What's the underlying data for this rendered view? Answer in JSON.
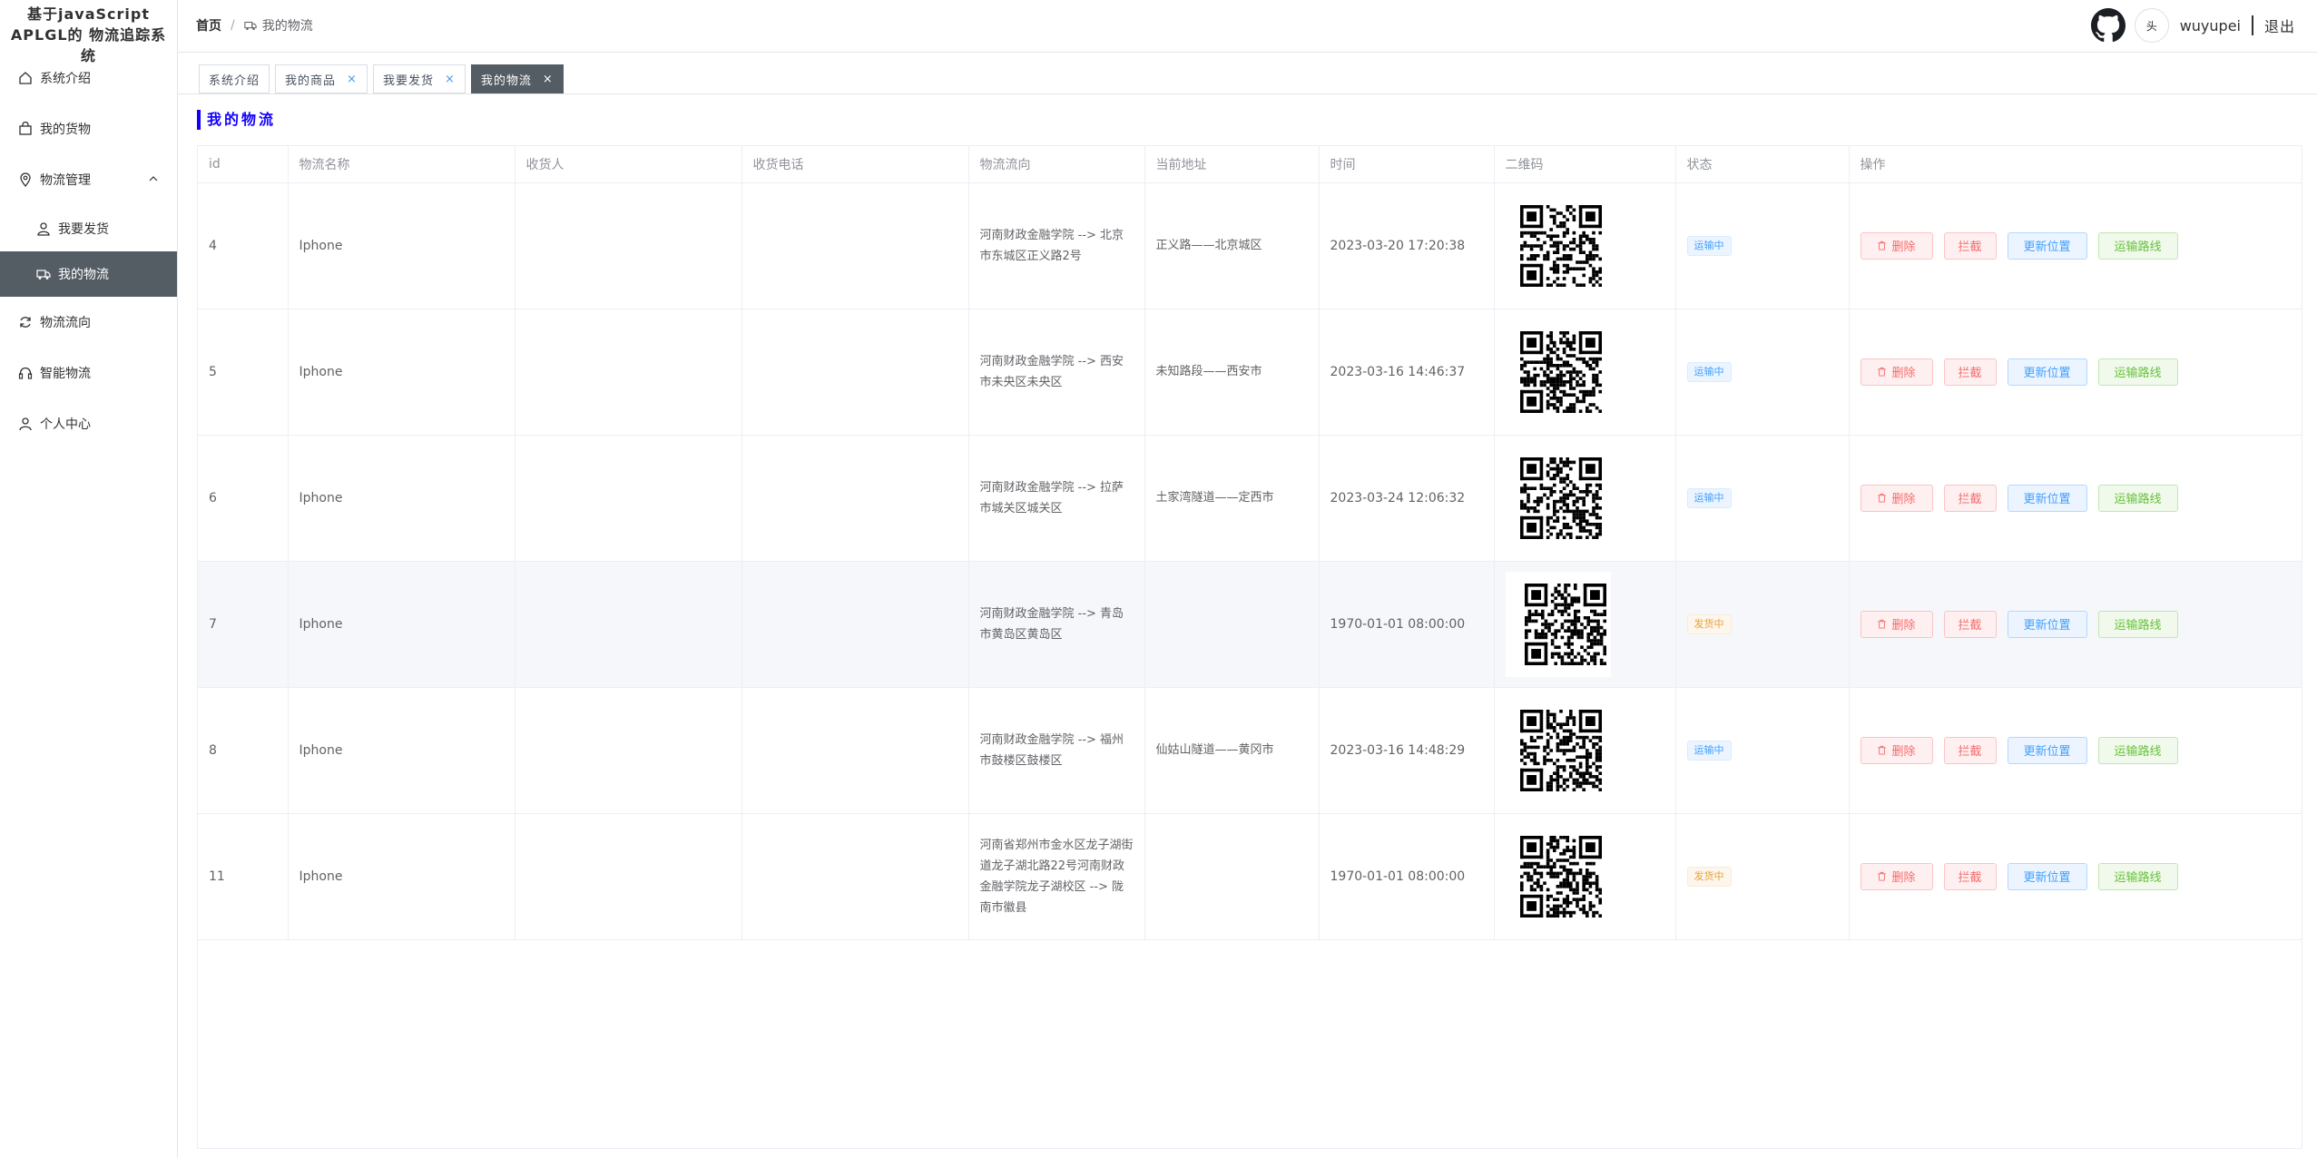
{
  "app": {
    "title": "基于javaScript APLGL的 物流追踪系统"
  },
  "sidebar": {
    "items": [
      {
        "label": "系统介绍",
        "icon": "home-icon"
      },
      {
        "label": "我的货物",
        "icon": "shopping-bag-icon"
      },
      {
        "label": "物流管理",
        "icon": "location-icon",
        "expanded": true
      },
      {
        "label": "我要发货",
        "icon": "user-icon"
      },
      {
        "label": "我的物流",
        "icon": "truck-icon",
        "active": true
      },
      {
        "label": "物流流向",
        "icon": "refresh-icon"
      },
      {
        "label": "智能物流",
        "icon": "headset-icon"
      },
      {
        "label": "个人中心",
        "icon": "user-icon"
      }
    ]
  },
  "header": {
    "breadcrumb_home": "首页",
    "breadcrumb_sep": "/",
    "breadcrumb_current": "我的物流",
    "avatar_text": "头",
    "username": "wuyupei",
    "logout": "退出"
  },
  "tabs": [
    {
      "label": "系统介绍",
      "closable": false
    },
    {
      "label": "我的商品",
      "closable": true
    },
    {
      "label": "我要发货",
      "closable": true
    },
    {
      "label": "我的物流",
      "closable": true,
      "active": true
    }
  ],
  "tab_close_glyph": "×",
  "section_title": "我的物流",
  "table": {
    "columns": [
      "id",
      "物流名称",
      "收货人",
      "收货电话",
      "物流流向",
      "当前地址",
      "时间",
      "二维码",
      "状态",
      "操作"
    ],
    "rows": [
      {
        "id": "4",
        "name": "Iphone",
        "receiver": "",
        "phone": "",
        "direction": "河南财政金融学院 --> 北京市东城区正义路2号",
        "address": "正义路——北京城区",
        "time": "2023-03-20 17:20:38",
        "status": "运输中",
        "status_color": "#409eff"
      },
      {
        "id": "5",
        "name": "Iphone",
        "receiver": "",
        "phone": "",
        "direction": "河南财政金融学院 --> 西安市未央区未央区",
        "address": "未知路段——西安市",
        "time": "2023-03-16 14:46:37",
        "status": "运输中",
        "status_color": "#409eff"
      },
      {
        "id": "6",
        "name": "Iphone",
        "receiver": "",
        "phone": "",
        "direction": "河南财政金融学院 --> 拉萨市城关区城关区",
        "address": "土家湾隧道——定西市",
        "time": "2023-03-24 12:06:32",
        "status": "运输中",
        "status_color": "#409eff"
      },
      {
        "id": "7",
        "name": "Iphone",
        "receiver": "",
        "phone": "",
        "direction": "河南财政金融学院 --> 青岛市黄岛区黄岛区",
        "address": "",
        "time": "1970-01-01 08:00:00",
        "status": "发货中",
        "status_color": "#e6a23c"
      },
      {
        "id": "8",
        "name": "Iphone",
        "receiver": "",
        "phone": "",
        "direction": "河南财政金融学院 --> 福州市鼓楼区鼓楼区",
        "address": "仙姑山隧道——黄冈市",
        "time": "2023-03-16 14:48:29",
        "status": "运输中",
        "status_color": "#409eff"
      },
      {
        "id": "11",
        "name": "Iphone",
        "receiver": "",
        "phone": "",
        "direction": "河南省郑州市金水区龙子湖街道龙子湖北路22号河南财政金融学院龙子湖校区 --> 陇南市徽县",
        "address": "",
        "time": "1970-01-01 08:00:00",
        "status": "发货中",
        "status_color": "#e6a23c"
      }
    ],
    "actions": {
      "delete": "删除",
      "intercept": "拦截",
      "update_position": "更新位置",
      "route": "运输路线"
    }
  },
  "colors": {
    "accent": "#1100ff",
    "active_menu_bg": "#545c64",
    "primary": "#409eff",
    "danger": "#f56c6c",
    "success": "#67c23a",
    "warning": "#e6a23c"
  }
}
